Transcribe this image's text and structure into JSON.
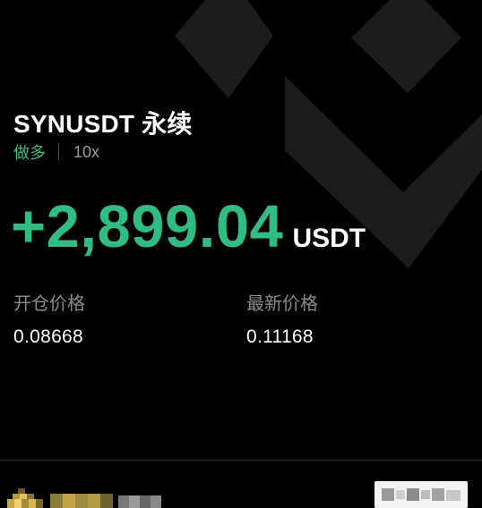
{
  "position": {
    "symbol": "SYNUSDT 永续",
    "side": "做多",
    "leverage": "10x"
  },
  "pnl": {
    "value": "+2,899.04",
    "unit": "USDT"
  },
  "prices": {
    "entry_label": "开仓价格",
    "entry_value": "0.08668",
    "last_label": "最新价格",
    "last_value": "0.11168"
  },
  "colors": {
    "profit": "#2ebd85",
    "background": "#000000",
    "label": "#8a8a8a"
  },
  "footer": {
    "avatar_icon": "blurred-avatar-icon",
    "qr_icon": "blurred-qr-code-icon"
  }
}
